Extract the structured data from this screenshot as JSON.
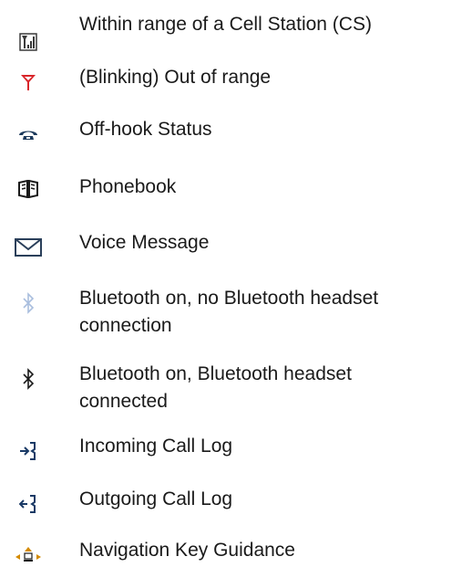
{
  "legend": {
    "items": [
      {
        "icon": "antenna-in-range-icon",
        "label": "Within range of a Cell Station (CS)",
        "color": "#3a3a3a"
      },
      {
        "icon": "antenna-out-of-range-icon",
        "label": "(Blinking) Out of range",
        "color": "#d9252a"
      },
      {
        "icon": "off-hook-phone-icon",
        "label": "Off-hook Status",
        "color": "#1d3a5c"
      },
      {
        "icon": "phonebook-icon",
        "label": "Phonebook",
        "color": "#1a1a1a"
      },
      {
        "icon": "envelope-icon",
        "label": "Voice Message",
        "color": "#2a3f5a"
      },
      {
        "icon": "bluetooth-light-icon",
        "label": "Bluetooth on, no Bluetooth headset",
        "label_line2": "connection",
        "color": "#a9bede"
      },
      {
        "icon": "bluetooth-dark-icon",
        "label": "Bluetooth on, Bluetooth headset",
        "label_line2": "connected",
        "color": "#1a1a1a"
      },
      {
        "icon": "incoming-call-log-icon",
        "label": "Incoming Call Log",
        "color": "#1a3a66"
      },
      {
        "icon": "outgoing-call-log-icon",
        "label": "Outgoing Call Log",
        "color": "#1a3a66"
      },
      {
        "icon": "navigation-key-icon",
        "label": "Navigation Key Guidance",
        "color": "#d48a00"
      }
    ]
  }
}
